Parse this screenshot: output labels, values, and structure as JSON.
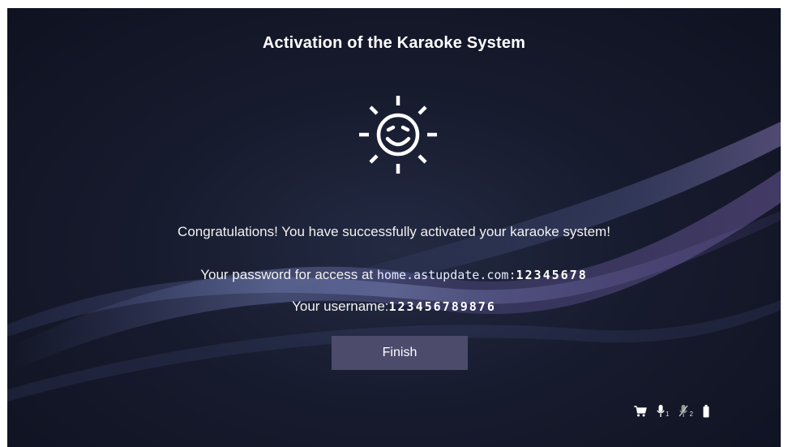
{
  "dialog": {
    "title": "Activation of the Karaoke System",
    "congratulations": "Congratulations! You have successfully activated your karaoke system!",
    "password_label": "Your password for access at",
    "access_url": "home.astupdate.com:",
    "password_value": "12345678",
    "username_label": "Your username:",
    "username_value": "123456789876",
    "finish_label": "Finish",
    "icon": "smiling-sun-icon"
  },
  "status_bar": {
    "icons": [
      "cart-icon",
      "microphone-icon",
      "microphone-muted-icon",
      "battery-icon"
    ],
    "mic1_index": "1",
    "mic2_index": "2"
  },
  "colors": {
    "background": "#171b2e",
    "button": "#4d4b6b",
    "text": "#ffffff"
  }
}
